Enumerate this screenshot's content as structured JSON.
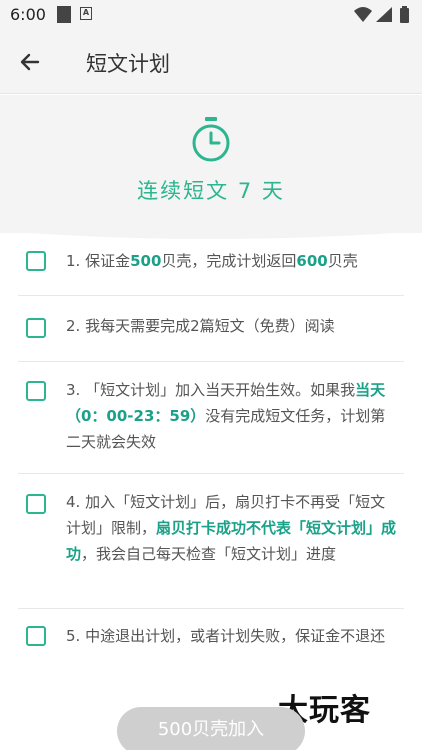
{
  "status_bar": {
    "time": "6:00",
    "icons": [
      "notification-square-icon",
      "a-badge-icon",
      "wifi-icon",
      "signal-icon",
      "battery-icon"
    ]
  },
  "app_bar": {
    "title": "短文计划",
    "back_icon": "back-arrow-icon"
  },
  "hero": {
    "icon": "timer-icon",
    "title": "连续短文 7 天",
    "accent_color": "#2cb58f"
  },
  "rules": [
    {
      "parts": [
        {
          "t": "1. 保证金",
          "hl": false
        },
        {
          "t": "500",
          "hl": true
        },
        {
          "t": "贝壳，完成计划返回",
          "hl": false
        },
        {
          "t": "600",
          "hl": true
        },
        {
          "t": "贝壳",
          "hl": false
        }
      ]
    },
    {
      "parts": [
        {
          "t": "2. 我每天需要完成2篇短文（免费）阅读",
          "hl": false
        }
      ]
    },
    {
      "parts": [
        {
          "t": "3. 「短文计划」加入当天开始生效。如果我",
          "hl": false
        },
        {
          "t": "当天（0：00-23：59）",
          "hl": true
        },
        {
          "t": "没有完成短文任务，计划第二天就会失效",
          "hl": false
        }
      ]
    },
    {
      "parts": [
        {
          "t": "4. 加入「短文计划」后，扇贝打卡不再受「短文计划」限制，",
          "hl": false
        },
        {
          "t": "扇贝打卡成功不代表「短文计划」成功",
          "hl": true
        },
        {
          "t": "，我会自己每天检查「短文计划」进度",
          "hl": false
        }
      ]
    },
    {
      "parts": [
        {
          "t": "5. 中途退出计划，或者计划失败，保证金不退还",
          "hl": false
        }
      ]
    }
  ],
  "join_button": {
    "label": "500贝壳加入"
  },
  "watermark": "大玩客"
}
